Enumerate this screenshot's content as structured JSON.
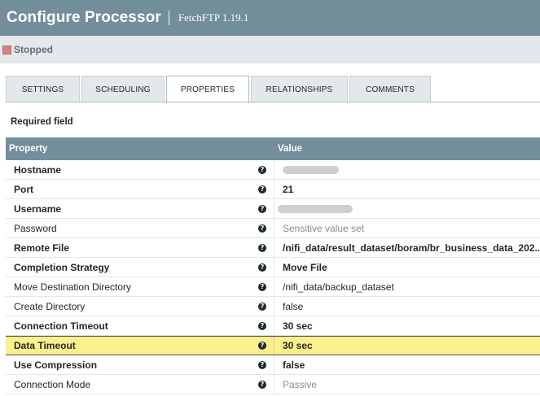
{
  "header": {
    "title": "Configure Processor",
    "subtitle": "FetchFTP 1.19.1"
  },
  "status": {
    "label": "Stopped",
    "color": "#d18686"
  },
  "tabs": [
    {
      "label": "SETTINGS",
      "active": false
    },
    {
      "label": "SCHEDULING",
      "active": false
    },
    {
      "label": "PROPERTIES",
      "active": true
    },
    {
      "label": "RELATIONSHIPS",
      "active": false
    },
    {
      "label": "COMMENTS",
      "active": false
    }
  ],
  "required_label": "Required field",
  "table": {
    "columns": [
      "Property",
      "Value"
    ],
    "rows": [
      {
        "name": "Hostname",
        "value": "",
        "required": true,
        "redacted": true
      },
      {
        "name": "Port",
        "value": "21",
        "required": true
      },
      {
        "name": "Username",
        "value": "",
        "required": true,
        "redacted": true
      },
      {
        "name": "Password",
        "value": "Sensitive value set",
        "required": false,
        "muted_value": true
      },
      {
        "name": "Remote File",
        "value": "/nifi_data/result_dataset/boram/br_business_data_202...",
        "required": true
      },
      {
        "name": "Completion Strategy",
        "value": "Move File",
        "required": true
      },
      {
        "name": "Move Destination Directory",
        "value": "/nifi_data/backup_dataset",
        "required": false
      },
      {
        "name": "Create Directory",
        "value": "false",
        "required": false
      },
      {
        "name": "Connection Timeout",
        "value": "30 sec",
        "required": true
      },
      {
        "name": "Data Timeout",
        "value": "30 sec",
        "required": true,
        "highlighted": true
      },
      {
        "name": "Use Compression",
        "value": "false",
        "required": true
      },
      {
        "name": "Connection Mode",
        "value": "Passive",
        "required": false
      }
    ]
  },
  "help_glyph": "?",
  "colors": {
    "header_bg": "#728e9b",
    "status_bg": "#e3e8eb",
    "highlight": "#fcf08d"
  }
}
